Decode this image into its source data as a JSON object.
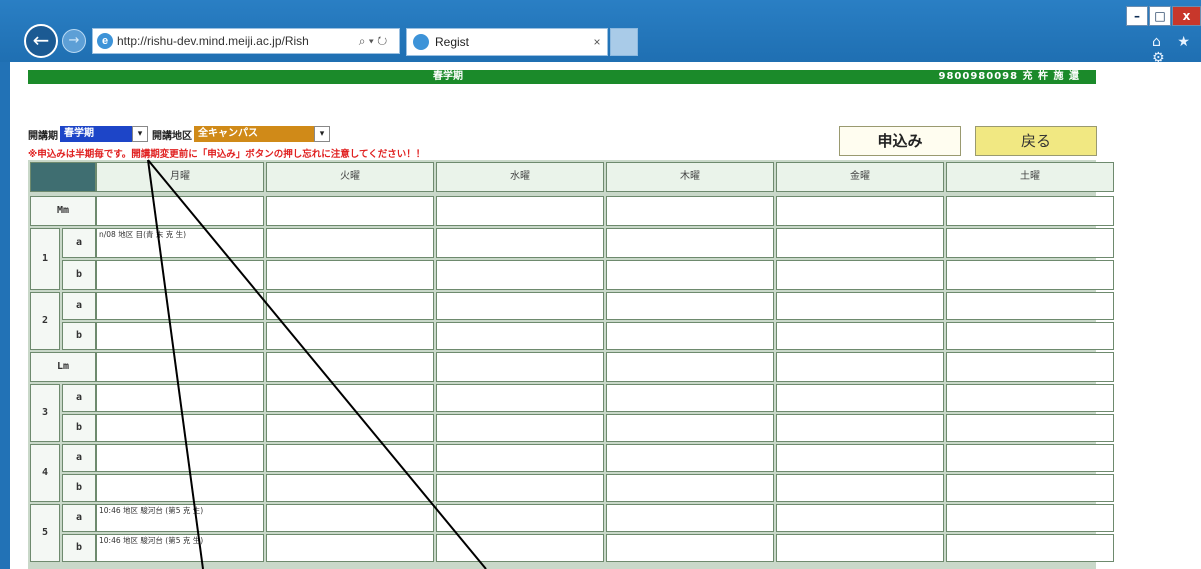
{
  "browser": {
    "url": "http://rishu-dev.mind.meiji.ac.jp/Rish",
    "tab_title": "Regist",
    "tab_close": "×",
    "search_glyph": "⌕ ▾ ↻",
    "back_glyph": "←",
    "forward_glyph": "→",
    "home_star": "⌂ ★ ⚙",
    "window": {
      "min": "–",
      "max": "□",
      "close": "x"
    }
  },
  "banner": {
    "term_label": "春学期",
    "user_info": "9800980098  充 杵 施 還"
  },
  "filters": {
    "term_label": "開講期",
    "term_value": "春学期",
    "area_label": "開講地区",
    "area_value": "全キャンパス",
    "arrow": "▾"
  },
  "warning": "※申込みは半期毎です。開講期変更前に「申込み」ボタンの押し忘れに注意してください！！",
  "buttons": {
    "apply": "申込み",
    "back": "戻る"
  },
  "timetable": {
    "days": [
      "月曜",
      "火曜",
      "水曜",
      "木曜",
      "金曜",
      "土曜"
    ],
    "mm": "Mm",
    "lm": "Lm",
    "periods": [
      "1",
      "2",
      "3",
      "4",
      "5"
    ],
    "sub_a": "a",
    "sub_b": "b",
    "courses": {
      "p1a_mon": "n/08 地区 目(青 末 克 生)",
      "p5a_mon": "10:46 地区 駿河台 (第5 克 生)",
      "p5b_mon": "10:46 地区 駿河台 (第5 克 生)"
    }
  },
  "colors": {
    "banner": "#1b8a2a",
    "term_select": "#1d45c8",
    "area_select": "#d08a18",
    "warning": "#e01f1f",
    "back_button": "#f1e882"
  }
}
